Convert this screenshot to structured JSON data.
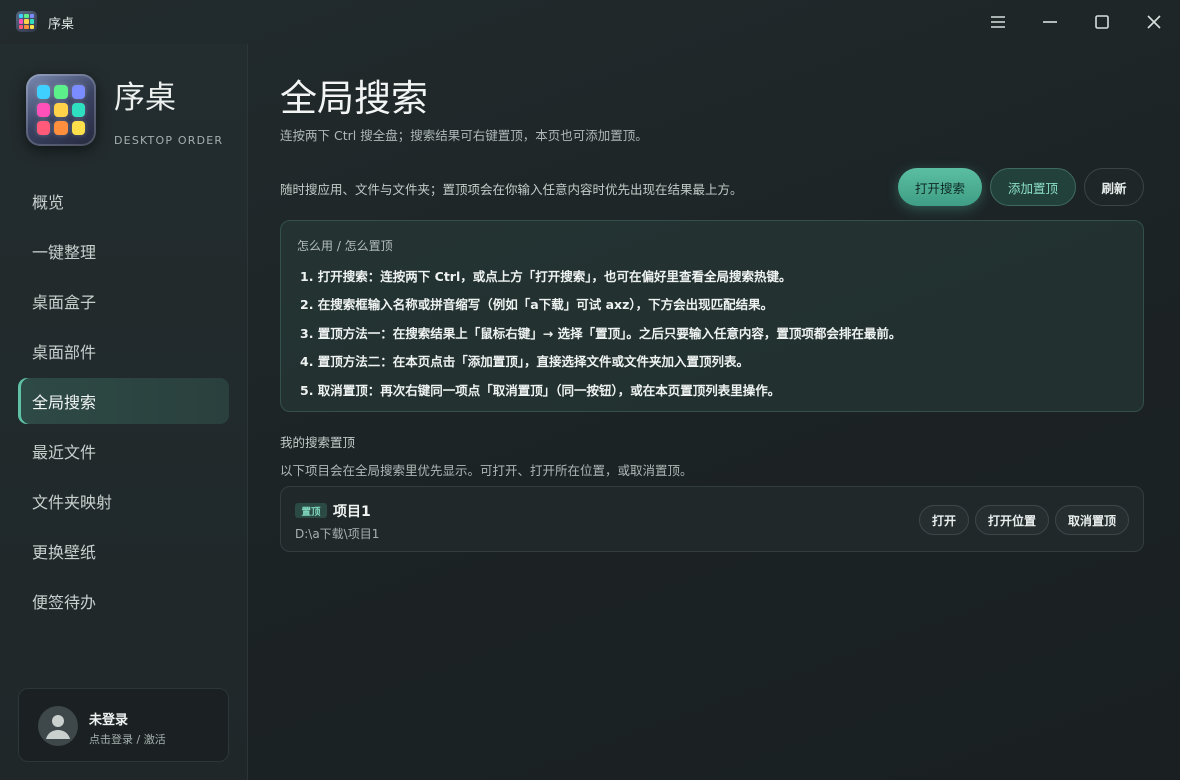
{
  "window": {
    "title": "序桌"
  },
  "brand": {
    "name": "序桌",
    "subtitle": "DESKTOP ORDER",
    "icon_colors": [
      "#3fd0ff",
      "#5cf08a",
      "#7a8cff",
      "#ff4fb8",
      "#ffd24a",
      "#2fe0c0",
      "#ff5a7a",
      "#ff8f3d",
      "#ffe04a"
    ]
  },
  "sidebar": {
    "items": [
      {
        "label": "概览"
      },
      {
        "label": "一键整理"
      },
      {
        "label": "桌面盒子"
      },
      {
        "label": "桌面部件"
      },
      {
        "label": "全局搜索",
        "active": true
      },
      {
        "label": "最近文件"
      },
      {
        "label": "文件夹映射"
      },
      {
        "label": "更换壁纸"
      },
      {
        "label": "便签待办"
      }
    ]
  },
  "user": {
    "name": "未登录",
    "subtitle": "点击登录 / 激活"
  },
  "main": {
    "title": "全局搜索",
    "subtitle": "连按两下 Ctrl 搜全盘；搜索结果可右键置顶，本页也可添加置顶。",
    "description": "随时搜应用、文件与文件夹；置顶项会在你输入任意内容时优先出现在结果最上方。",
    "buttons": {
      "open_search": "打开搜索",
      "add_pin": "添加置顶",
      "refresh": "刷新"
    },
    "howto": {
      "title": "怎么用 / 怎么置顶",
      "steps": [
        "1. 打开搜索：连按两下 Ctrl，或点上方「打开搜索」，也可在偏好里查看全局搜索热键。",
        "2. 在搜索框输入名称或拼音缩写（例如「a下载」可试 axz），下方会出现匹配结果。",
        "3. 置顶方法一：在搜索结果上「鼠标右键」→ 选择「置顶」。之后只要输入任意内容，置顶项都会排在最前。",
        "4. 置顶方法二：在本页点击「添加置顶」，直接选择文件或文件夹加入置顶列表。",
        "5. 取消置顶：再次右键同一项点「取消置顶」（同一按钮），或在本页置顶列表里操作。"
      ]
    },
    "pins": {
      "title": "我的搜索置顶",
      "description": "以下项目会在全局搜索里优先显示。可打开、打开所在位置，或取消置顶。",
      "items": [
        {
          "badge": "置顶",
          "name": "项目1",
          "path": "D:\\a下载\\项目1",
          "actions": {
            "open": "打开",
            "open_location": "打开位置",
            "unpin": "取消置顶"
          }
        }
      ]
    }
  },
  "colors": {
    "accent": "#5bbea2",
    "active_nav": "#2e4a46"
  }
}
